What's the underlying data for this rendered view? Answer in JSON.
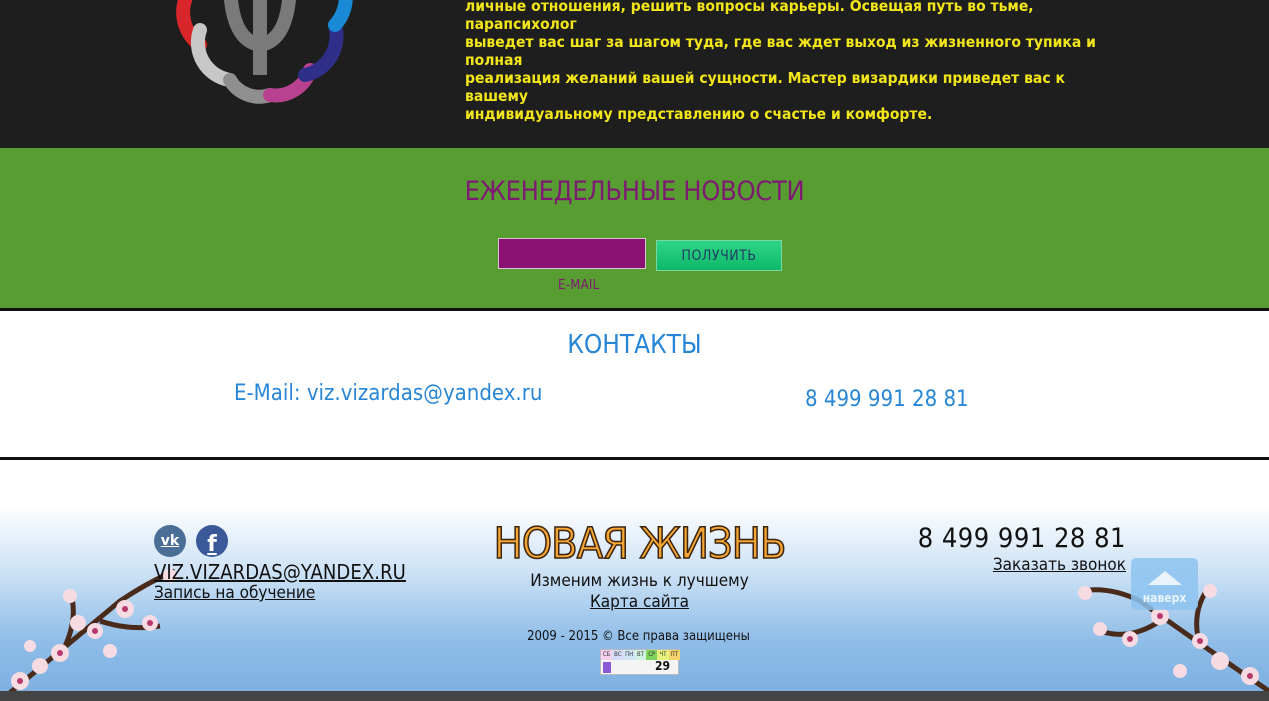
{
  "intro": {
    "text_lines": [
      "личные отношения, решить вопросы карьеры. Освещая путь во тьме, парапсихолог",
      "выведет вас шаг за шагом туда, где вас ждет выход из жизненного тупика и полная",
      "реализация желаний вашей сущности. Мастер визардики приведет вас к вашему",
      "индивидуальному представлению о счастье и комфорте."
    ],
    "logo_icon": "psi-flower-logo-icon"
  },
  "newsletter": {
    "title": "ЕЖЕНЕДЕЛЬНЫЕ НОВОСТИ",
    "input_value": "",
    "input_label": "E-MAIL",
    "button_label": "ПОЛУЧИТЬ",
    "colors": {
      "band": "#579d32",
      "title": "#7f1a73",
      "input": "#8a1274",
      "button": "#13c072"
    }
  },
  "contacts": {
    "title": "КОНТАКТЫ",
    "email_prefix": "E-Mail: ",
    "email": "viz.vizardas@yandex.ru",
    "phone": "8 499 991 28 81",
    "color": "#2886d6"
  },
  "footer": {
    "social": [
      {
        "name": "vk",
        "icon": "vk-icon",
        "glyph": "vk"
      },
      {
        "name": "facebook",
        "icon": "facebook-icon",
        "glyph": "f"
      }
    ],
    "email": "VIZ.VIZARDAS@YANDEX.RU",
    "signup_link": "Запись на обучение",
    "brand": "НОВАЯ ЖИЗНЬ",
    "tagline": "Изменим жизнь к лучшему",
    "sitemap_link": "Карта сайта",
    "copyright": "2009 - 2015 © Все права защищены",
    "counter": {
      "days": [
        "СБ",
        "ВС",
        "ПН",
        "ВТ",
        "СР",
        "ЧТ",
        "ПТ"
      ],
      "value": "29"
    },
    "phone": "8 499 991 28 81",
    "callback_link": "Заказать звонок"
  },
  "scroll_top": {
    "label": "наверх",
    "icon": "arrow-up-icon"
  }
}
